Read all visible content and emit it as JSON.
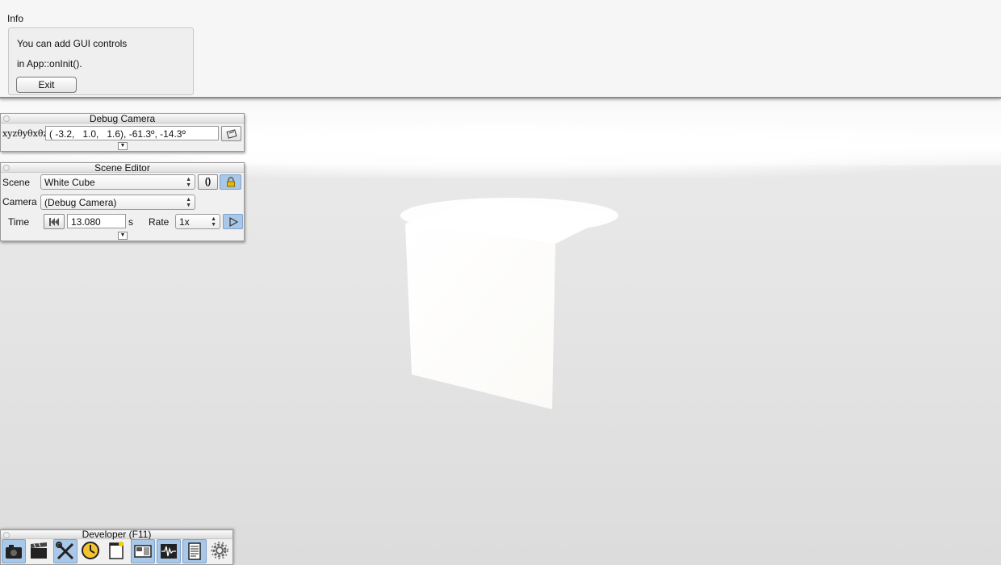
{
  "info": {
    "title": "Info",
    "line1": "You can add GUI controls",
    "line2": "in App::onInit().",
    "exit_label": "Exit"
  },
  "debug_camera": {
    "title": "Debug Camera",
    "coord_label": "xyzθyθxθz",
    "value": "( -3.2,   1.0,   1.6), -61.3º, -14.3º"
  },
  "scene_editor": {
    "title": "Scene Editor",
    "scene_label": "Scene",
    "scene_value": "White Cube",
    "camera_label": "Camera",
    "camera_value": "(Debug Camera)",
    "time_label": "Time",
    "time_value": "13.080",
    "time_unit": "s",
    "rate_label": "Rate",
    "rate_value": "1x"
  },
  "developer": {
    "title": "Developer (F11)",
    "tools": [
      {
        "icon": "camera-icon",
        "active": true
      },
      {
        "icon": "clapperboard-icon",
        "active": false
      },
      {
        "icon": "tools-icon",
        "active": true
      },
      {
        "icon": "profiler-clock-icon",
        "active": false
      },
      {
        "icon": "window-icon",
        "active": false
      },
      {
        "icon": "scene-windows-icon",
        "active": true
      },
      {
        "icon": "waveform-icon",
        "active": true
      },
      {
        "icon": "log-document-icon",
        "active": true
      },
      {
        "icon": "settings-gear-icon",
        "active": false
      }
    ]
  },
  "colors": {
    "toolbar_active": "#a9c7e6",
    "window_bg": "#f0f0f0"
  }
}
